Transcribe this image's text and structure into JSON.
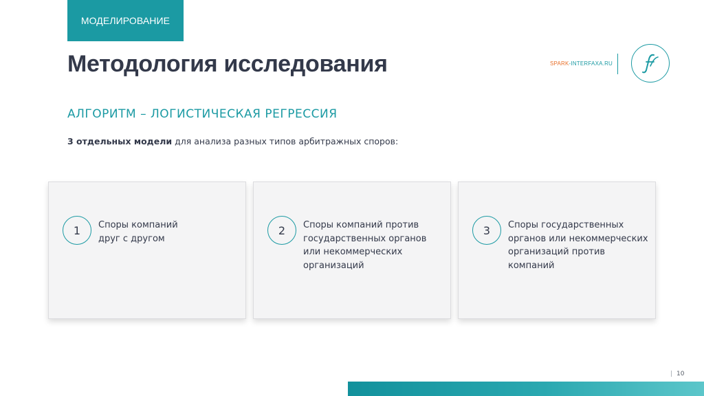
{
  "section_tag": "МОДЕЛИРОВАНИЕ",
  "title": "Методология исследования",
  "brand": {
    "prefix": "SPARK",
    "suffix": "-INTERFAXA.RU",
    "accent_color": "#e8702a",
    "logo_icon": "interfax-f-logo-icon"
  },
  "subtitle": "АЛГОРИТМ – ЛОГИСТИЧЕСКАЯ РЕГРЕССИЯ",
  "intro": {
    "bold": "3 отдельных модели",
    "rest": " для анализа разных типов арбитражных споров:"
  },
  "cards": [
    {
      "number": "1",
      "lines": [
        "Споры компаний",
        "друг с другом"
      ]
    },
    {
      "number": "2",
      "lines": [
        "Споры компаний против",
        "государственных органов",
        "или некоммерческих",
        "организаций"
      ]
    },
    {
      "number": "3",
      "lines": [
        "Споры государственных",
        "органов или некоммерческих",
        "организаций против",
        "компаний"
      ]
    }
  ],
  "page_number": "10",
  "colors": {
    "accent": "#1b9aa3",
    "text": "#33394a",
    "card_bg": "#f4f4f5"
  }
}
